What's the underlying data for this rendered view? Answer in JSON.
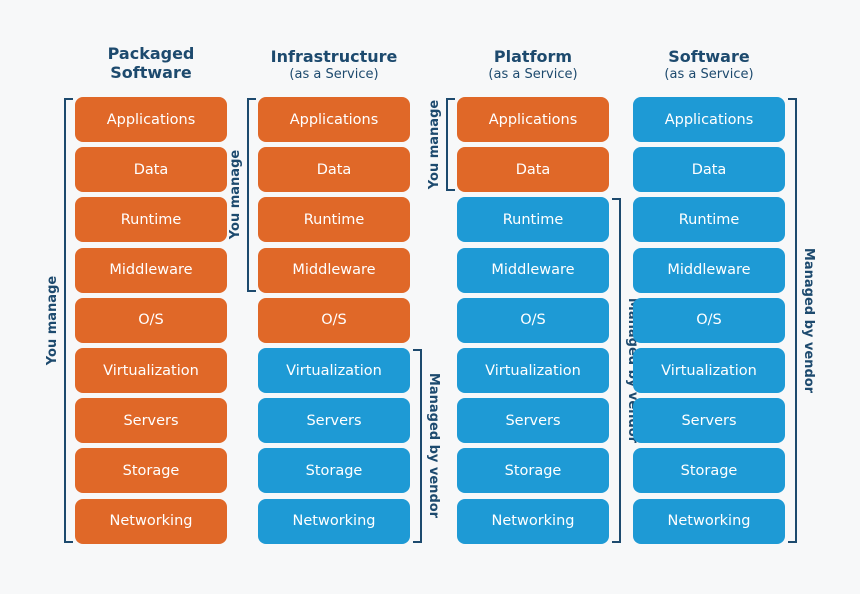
{
  "columns": [
    {
      "title": "Packaged",
      "subtitle": "Software",
      "layers": [
        "Applications",
        "Data",
        "Runtime",
        "Middleware",
        "O/S",
        "Virtualization",
        "Servers",
        "Storage",
        "Networking"
      ],
      "managed_by": [
        "you",
        "you",
        "you",
        "you",
        "you",
        "you",
        "you",
        "you",
        "you"
      ],
      "brackets": [
        {
          "label": "You manage",
          "side": "left",
          "from": 0,
          "to": 8
        }
      ]
    },
    {
      "title": "Infrastructure",
      "subtitle": "(as a Service)",
      "layers": [
        "Applications",
        "Data",
        "Runtime",
        "Middleware",
        "O/S",
        "Virtualization",
        "Servers",
        "Storage",
        "Networking"
      ],
      "managed_by": [
        "you",
        "you",
        "you",
        "you",
        "you",
        "vendor",
        "vendor",
        "vendor",
        "vendor"
      ],
      "brackets": [
        {
          "label": "You manage",
          "side": "left",
          "from": 0,
          "to": 3
        },
        {
          "label": "Managed by vendor",
          "side": "right",
          "from": 5,
          "to": 8
        }
      ]
    },
    {
      "title": "Platform",
      "subtitle": "(as a Service)",
      "layers": [
        "Applications",
        "Data",
        "Runtime",
        "Middleware",
        "O/S",
        "Virtualization",
        "Servers",
        "Storage",
        "Networking"
      ],
      "managed_by": [
        "you",
        "you",
        "vendor",
        "vendor",
        "vendor",
        "vendor",
        "vendor",
        "vendor",
        "vendor"
      ],
      "brackets": [
        {
          "label": "You manage",
          "side": "left",
          "from": 0,
          "to": 1
        },
        {
          "label": "Managed by vendor",
          "side": "right",
          "from": 2,
          "to": 8
        }
      ]
    },
    {
      "title": "Software",
      "subtitle": "(as a Service)",
      "layers": [
        "Applications",
        "Data",
        "Runtime",
        "Middleware",
        "O/S",
        "Virtualization",
        "Servers",
        "Storage",
        "Networking"
      ],
      "managed_by": [
        "vendor",
        "vendor",
        "vendor",
        "vendor",
        "vendor",
        "vendor",
        "vendor",
        "vendor",
        "vendor"
      ],
      "brackets": [
        {
          "label": "Managed by vendor",
          "side": "right",
          "from": 0,
          "to": 8
        }
      ]
    }
  ],
  "colors": {
    "you": "#e06828",
    "vendor": "#1e9ad5",
    "text_dark": "#1d4a6e"
  }
}
